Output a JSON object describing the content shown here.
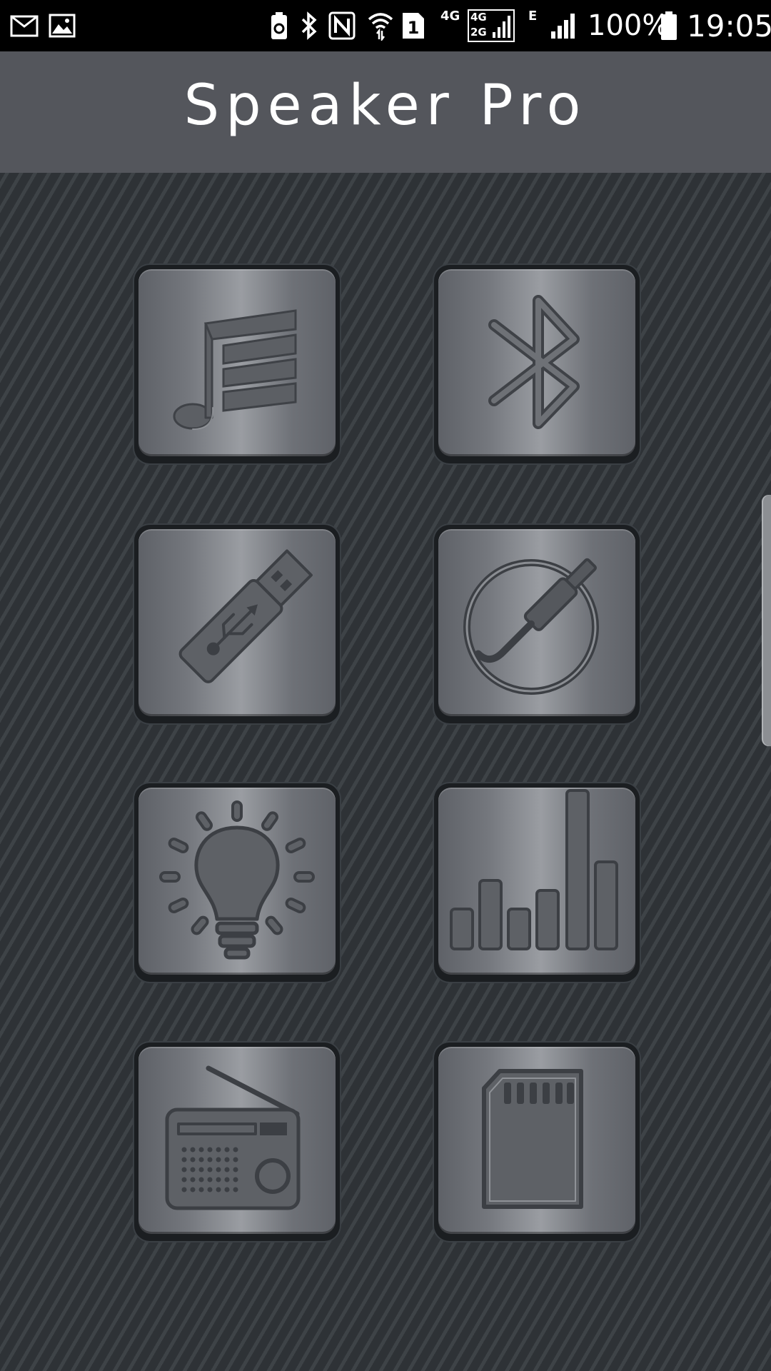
{
  "status_bar": {
    "left_icons": [
      "email-icon",
      "gallery-icon"
    ],
    "right_icons": [
      "battery-saver-icon",
      "bluetooth-icon",
      "nfc-icon",
      "wifi-icon",
      "sim-1-icon"
    ],
    "network_4g": "4G",
    "network_4g_2g_top": "4G",
    "network_4g_2g_bottom": "2G",
    "network_e": "E",
    "battery_percent": "100%",
    "time": "19:05"
  },
  "header": {
    "title": "Speaker Pro"
  },
  "tiles": [
    {
      "name": "music",
      "icon": "music-notes-icon"
    },
    {
      "name": "bluetooth",
      "icon": "bluetooth-icon"
    },
    {
      "name": "usb",
      "icon": "usb-drive-icon"
    },
    {
      "name": "aux",
      "icon": "audio-jack-icon"
    },
    {
      "name": "light",
      "icon": "light-bulb-icon"
    },
    {
      "name": "equalizer",
      "icon": "equalizer-bars-icon"
    },
    {
      "name": "radio",
      "icon": "radio-icon"
    },
    {
      "name": "sd-card",
      "icon": "sd-card-icon"
    }
  ],
  "colors": {
    "status_bar_bg": "#000000",
    "header_bg": "#54565c",
    "background": "#2e3236",
    "stripe": "#3e4347",
    "tile_metal_light": "#9a9da2",
    "tile_metal_dark": "#5e6167",
    "icon_engrave": "#4a4d52"
  }
}
